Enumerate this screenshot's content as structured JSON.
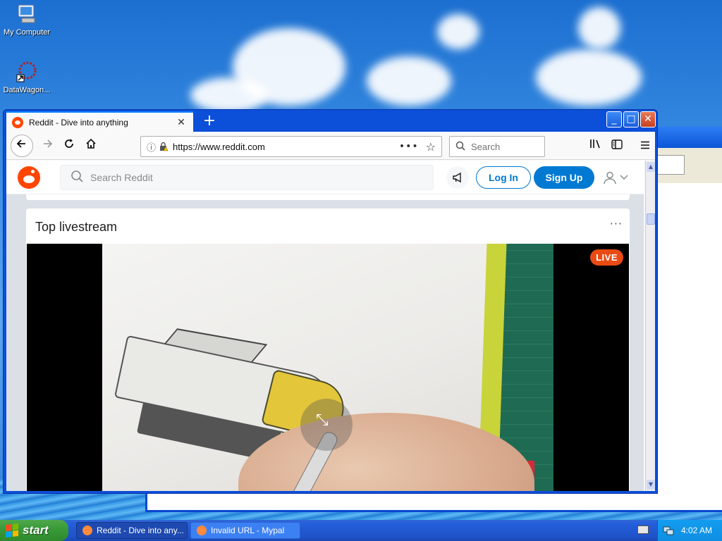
{
  "desktop": {
    "icons": [
      {
        "label": "My Computer"
      },
      {
        "label": "DataWagon..."
      }
    ]
  },
  "browser": {
    "tab": {
      "title": "Reddit - Dive into anything",
      "close": "✕"
    },
    "new_tab": "+",
    "window_buttons": {
      "minimize": "_",
      "maximize": "□",
      "close": "✕"
    },
    "url": "https://www.reddit.com",
    "url_more": "•••",
    "search_placeholder": "Search"
  },
  "reddit": {
    "search_placeholder": "Search Reddit",
    "login_label": "Log In",
    "signup_label": "Sign Up",
    "card_title": "Top livestream",
    "card_more": "···",
    "live_badge": "LIVE"
  },
  "taskbar": {
    "start_label": "start",
    "items": [
      {
        "label": "Reddit - Dive into any..."
      },
      {
        "label": "Invalid URL - Mypal"
      }
    ],
    "clock": "4:02 AM"
  },
  "colors": {
    "reddit_orange": "#ff4500",
    "reddit_blue": "#0079d3",
    "live_red": "#ea4b14",
    "xp_blue": "#0c4fd8"
  }
}
